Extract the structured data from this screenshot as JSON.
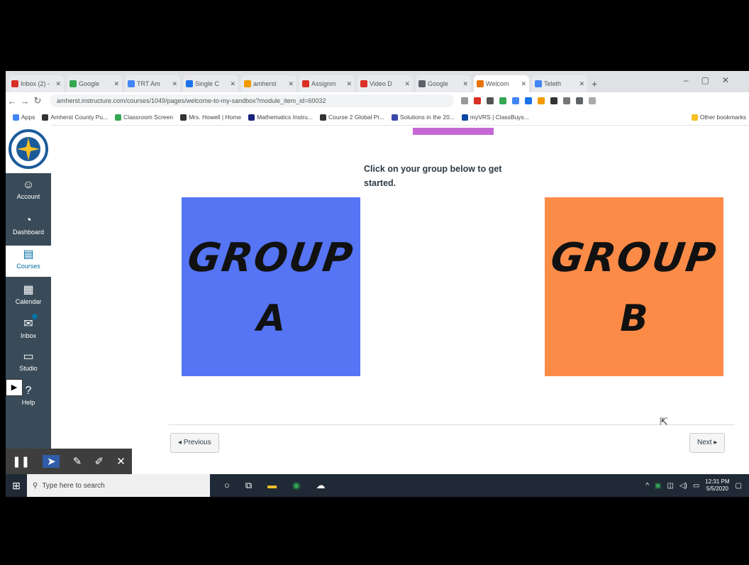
{
  "browser": {
    "tabs": [
      {
        "label": "Inbox (2) -",
        "color": "#d93025",
        "active": false
      },
      {
        "label": "Google",
        "color": "#34a853",
        "active": false
      },
      {
        "label": "TRT Am",
        "color": "#4285f4",
        "active": false
      },
      {
        "label": "Single C",
        "color": "#1a73e8",
        "active": false
      },
      {
        "label": "amherst",
        "color": "#f29900",
        "active": false
      },
      {
        "label": "Assignm",
        "color": "#d93025",
        "active": false
      },
      {
        "label": "Video D",
        "color": "#d93025",
        "active": false
      },
      {
        "label": "Google",
        "color": "#5f6368",
        "active": false
      },
      {
        "label": "Welcom",
        "color": "#e8710a",
        "active": true
      },
      {
        "label": "Teleth",
        "color": "#4285f4",
        "active": false
      }
    ],
    "new_tab": "+",
    "url": "amherst.instructure.com/courses/1049/pages/welcome-to-my-sandbox?module_item_id=60032",
    "bookmarks": [
      {
        "label": "Apps",
        "color": "#4285f4"
      },
      {
        "label": "Amherst County Pu...",
        "color": "#333"
      },
      {
        "label": "Classroom Screen",
        "color": "#34a853"
      },
      {
        "label": "Mrs. Howell | Home",
        "color": "#333"
      },
      {
        "label": "Mathematics Instru...",
        "color": "#1a237e"
      },
      {
        "label": "Course 2 Global Pr...",
        "color": "#333"
      },
      {
        "label": "Solutions in the 20...",
        "color": "#3949ab"
      },
      {
        "label": "myVRS | ClassBuys...",
        "color": "#0d47a1"
      }
    ],
    "other_bookmarks": "Other bookmarks"
  },
  "sidebar": {
    "items": [
      {
        "label": "Account",
        "icon": "account-icon",
        "glyph": "☺"
      },
      {
        "label": "Dashboard",
        "icon": "dashboard-icon",
        "glyph": "◔"
      },
      {
        "label": "Courses",
        "icon": "courses-icon",
        "glyph": "▤"
      },
      {
        "label": "Calendar",
        "icon": "calendar-icon",
        "glyph": "▦"
      },
      {
        "label": "Inbox",
        "icon": "inbox-icon",
        "glyph": "✉"
      },
      {
        "label": "Studio",
        "icon": "studio-icon",
        "glyph": "▭"
      },
      {
        "label": "Help",
        "icon": "help-icon",
        "glyph": "?"
      }
    ]
  },
  "content": {
    "instruction": "Click on your group below to get started.",
    "group_a": {
      "line1": "GROUP",
      "line2": "A",
      "color": "#5575f4"
    },
    "group_b": {
      "line1": "GROUP",
      "line2": "B",
      "color": "#fb8b47"
    },
    "previous": "◂ Previous",
    "next": "Next ▸"
  },
  "taskbar": {
    "search_placeholder": "Type here to search",
    "time": "12:31 PM",
    "date": "5/5/2020"
  }
}
